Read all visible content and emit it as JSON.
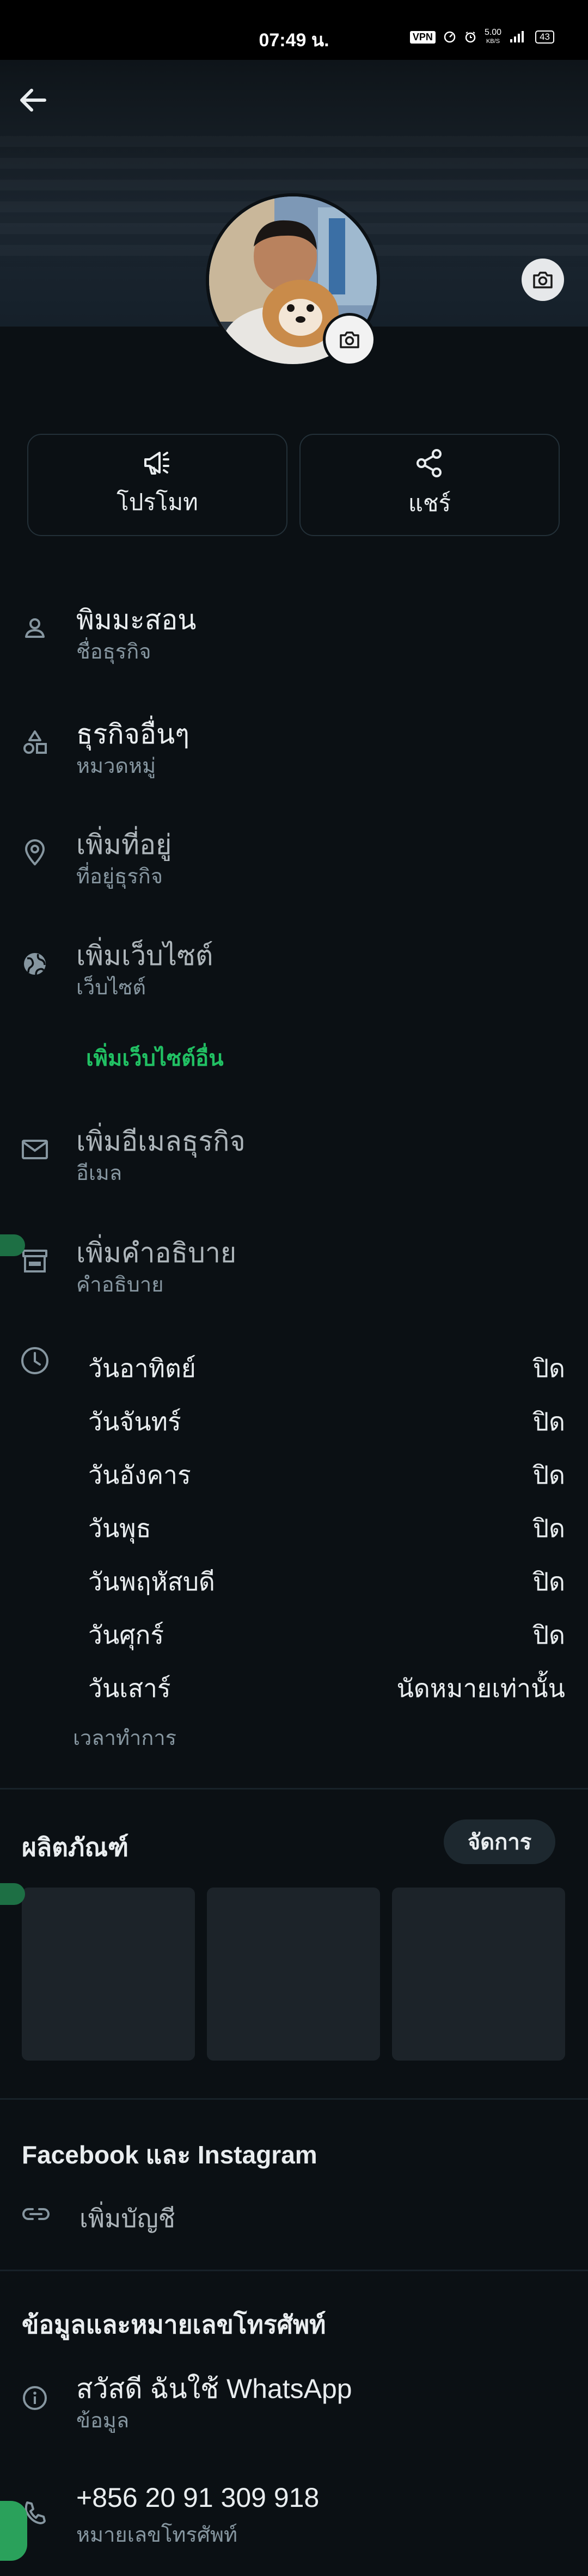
{
  "status_bar": {
    "time": "07:49 น.",
    "vpn": "VPN",
    "net_speed": "5.00",
    "net_unit": "KB/S",
    "battery": "43"
  },
  "profile": {
    "promote_label": "โปรโมท",
    "share_label": "แชร์"
  },
  "details": {
    "name": {
      "value": "พิมมะสอน",
      "caption": "ชื่อธุรกิจ"
    },
    "category": {
      "value": "ธุรกิจอื่นๆ",
      "caption": "หมวดหมู่"
    },
    "address": {
      "value": "เพิ่มที่อยู่",
      "caption": "ที่อยู่ธุรกิจ"
    },
    "website": {
      "value": "เพิ่มเว็บไซต์",
      "caption": "เว็บไซต์",
      "add_other": "เพิ่มเว็บไซต์อื่น"
    },
    "email": {
      "value": "เพิ่มอีเมลธุรกิจ",
      "caption": "อีเมล"
    },
    "description": {
      "value": "เพิ่มคำอธิบาย",
      "caption": "คำอธิบาย"
    }
  },
  "hours": {
    "days": [
      {
        "day": "วันอาทิตย์",
        "status": "ปิด"
      },
      {
        "day": "วันจันทร์",
        "status": "ปิด"
      },
      {
        "day": "วันอังคาร",
        "status": "ปิด"
      },
      {
        "day": "วันพุธ",
        "status": "ปิด"
      },
      {
        "day": "วันพฤหัสบดี",
        "status": "ปิด"
      },
      {
        "day": "วันศุกร์",
        "status": "ปิด"
      },
      {
        "day": "วันเสาร์",
        "status": "นัดหมายเท่านั้น"
      }
    ],
    "caption": "เวลาทำการ"
  },
  "products": {
    "title": "ผลิตภัณฑ์",
    "manage_label": "จัดการ"
  },
  "social": {
    "title": "Facebook และ Instagram",
    "add_account": "เพิ่มบัญชี"
  },
  "contact": {
    "title": "ข้อมูลและหมายเลขโทรศัพท์",
    "about": {
      "value": "สวัสดี ฉันใช้ WhatsApp",
      "caption": "ข้อมูล"
    },
    "phone": {
      "value": "+856 20 91 309 918",
      "caption": "หมายเลขโทรศัพท์"
    }
  },
  "colors": {
    "background": "#0b1014",
    "accent": "#21c063",
    "text_primary": "#e9edef",
    "text_secondary": "#8696a0"
  }
}
